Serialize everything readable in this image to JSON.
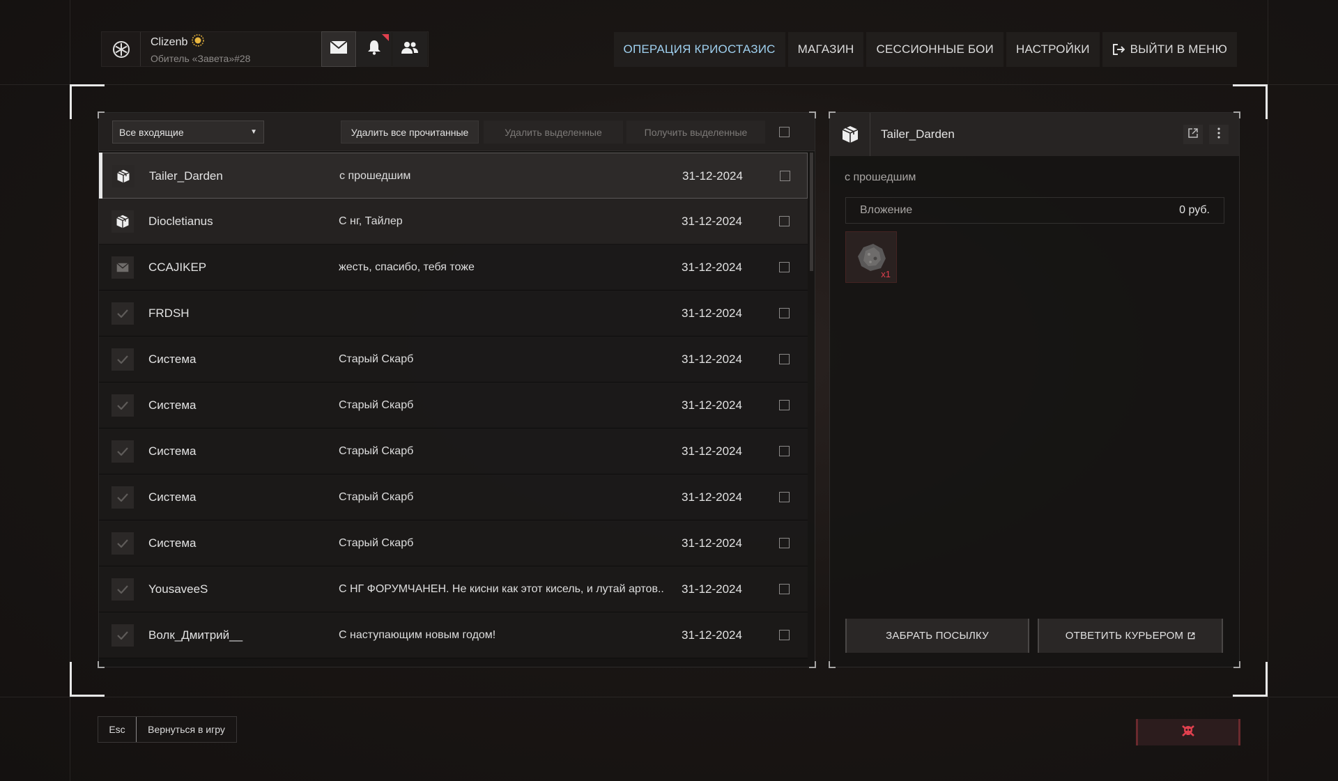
{
  "profile": {
    "name": "Clizenb",
    "subtitle": "Обитель «Завета»#28",
    "logo_icon": "snowflake-icon",
    "rank_icon": "sun-badge-icon"
  },
  "header_buttons": {
    "mail_icon": "envelope-icon",
    "notifications_icon": "bell-icon",
    "friends_icon": "users-icon"
  },
  "nav": {
    "operation": "ОПЕРАЦИЯ КРИОСТАЗИС",
    "shop": "МАГАЗИН",
    "sessions": "СЕССИОННЫЕ БОИ",
    "settings": "НАСТРОЙКИ",
    "exit": "ВЫЙТИ В МЕНЮ"
  },
  "colors": {
    "accent": "#9fd0ef",
    "alert": "#e0404e"
  },
  "inbox": {
    "filter_value": "Все входящие",
    "delete_read": "Удалить все прочитанные",
    "delete_selected": "Удалить выделенные",
    "receive_selected": "Получить выделенные",
    "messages": [
      {
        "icon": "package-icon",
        "sender": "Tailer_Darden",
        "subject": "с прошедшим",
        "date": "31-12-2024"
      },
      {
        "icon": "package-icon",
        "sender": "Diocletianus",
        "subject": "С нг, Тайлер",
        "date": "31-12-2024"
      },
      {
        "icon": "envelope-icon",
        "sender": "CCAJIKEP",
        "subject": "жесть, спасибо, тебя тоже",
        "date": "31-12-2024"
      },
      {
        "icon": "check-icon",
        "sender": "FRDSH",
        "subject": "",
        "date": "31-12-2024"
      },
      {
        "icon": "check-icon",
        "sender": "Система",
        "subject": "Старый Скарб",
        "date": "31-12-2024"
      },
      {
        "icon": "check-icon",
        "sender": "Система",
        "subject": "Старый Скарб",
        "date": "31-12-2024"
      },
      {
        "icon": "check-icon",
        "sender": "Система",
        "subject": "Старый Скарб",
        "date": "31-12-2024"
      },
      {
        "icon": "check-icon",
        "sender": "Система",
        "subject": "Старый Скарб",
        "date": "31-12-2024"
      },
      {
        "icon": "check-icon",
        "sender": "Система",
        "subject": "Старый Скарб",
        "date": "31-12-2024"
      },
      {
        "icon": "check-icon",
        "sender": "YousaveeS",
        "subject": "С НГ ФОРУМЧАНЕН. Не кисни как этот кисель, и лутай артов..",
        "date": "31-12-2024"
      },
      {
        "icon": "check-icon",
        "sender": "Волк_Дмитрий__",
        "subject": "С наступающим новым годом!",
        "date": "31-12-2024"
      }
    ]
  },
  "detail": {
    "sender": "Tailer_Darden",
    "subject": "с прошедшим",
    "attachment_label": "Вложение",
    "attachment_amount": "0 руб.",
    "item_qty": "x1",
    "item_icon": "ore-chunk-icon",
    "take_parcel": "ЗАБРАТЬ ПОСЫЛКУ",
    "reply_courier": "ОТВЕТИТЬ КУРЬЕРОМ"
  },
  "footer": {
    "esc_key": "Esc",
    "back_label": "Вернуться в игру",
    "danger_icon": "skull-crossbones-icon"
  }
}
